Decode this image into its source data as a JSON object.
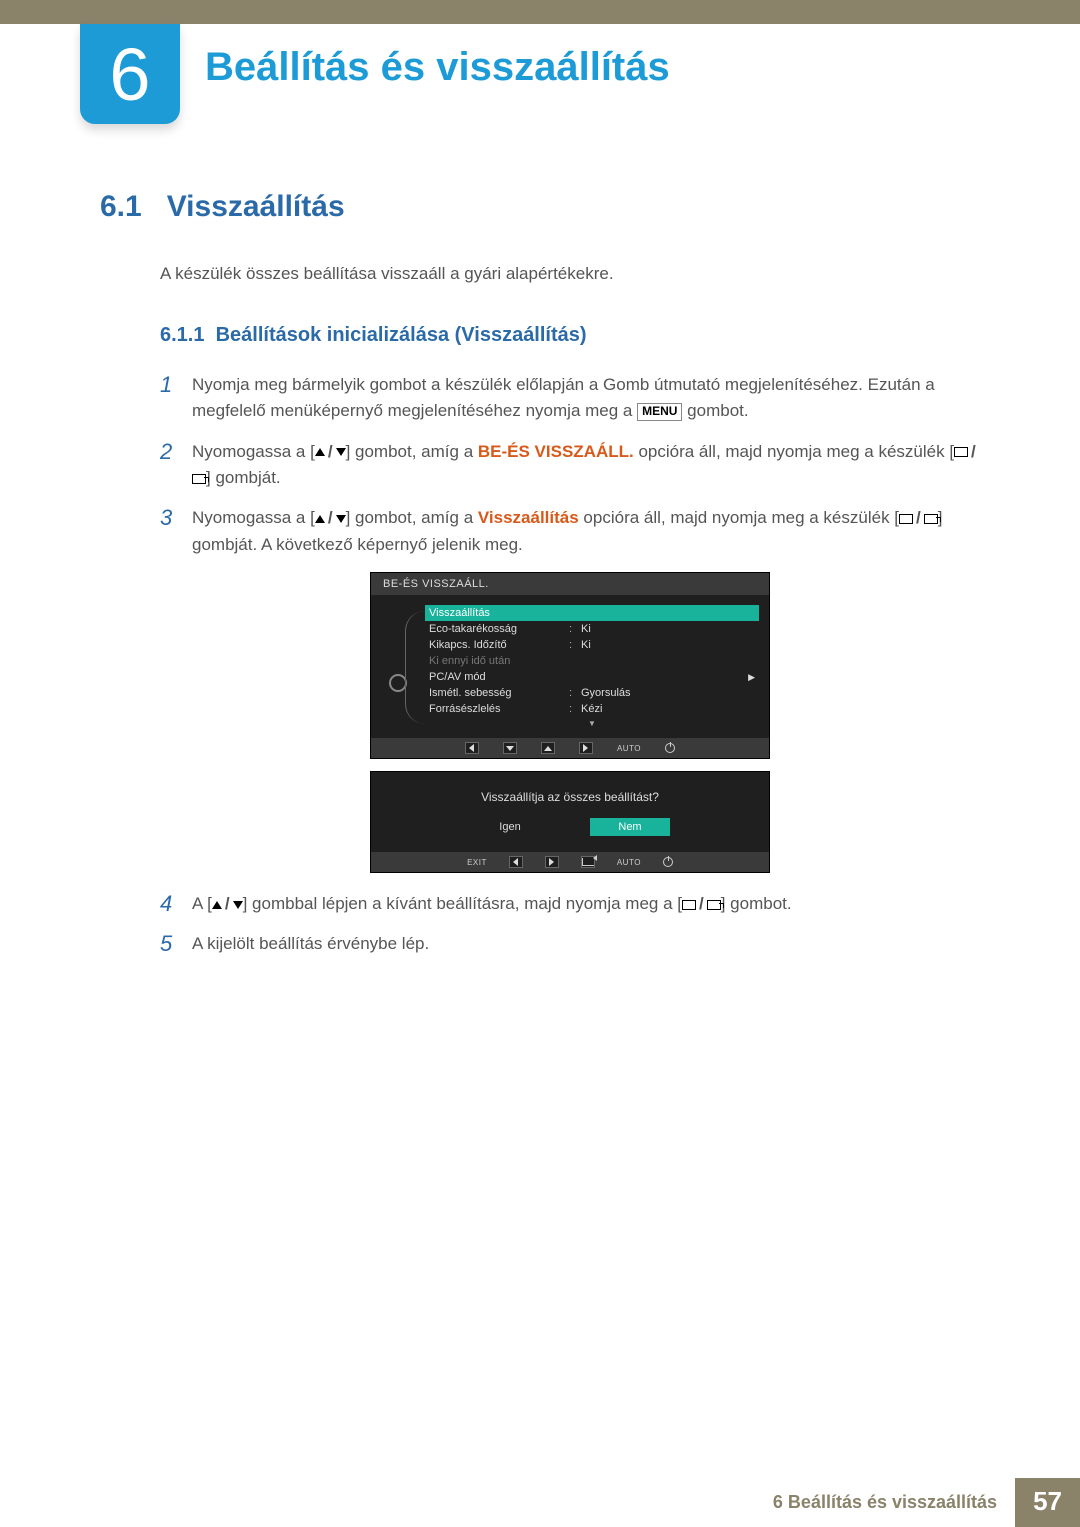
{
  "chapter": {
    "number": "6",
    "title": "Beállítás és visszaállítás"
  },
  "section": {
    "number": "6.1",
    "title": "Visszaállítás"
  },
  "intro": "A készülék összes beállítása visszaáll a gyári alapértékekre.",
  "subsection": {
    "number": "6.1.1",
    "title": "Beállítások inicializálása (Visszaállítás)"
  },
  "steps": {
    "s1": "Nyomja meg bármelyik gombot a készülék előlapján a Gomb útmutató megjelenítéséhez. Ezután a megfelelő menüképernyő megjelenítéséhez nyomja meg a ",
    "s1b": " gombot.",
    "s2a": "Nyomogassa a [",
    "s2b": "] gombot, amíg a ",
    "s2hl": "BE-ÉS VISSZAÁLL.",
    "s2c": " opcióra áll, majd nyomja meg a készülék [",
    "s2d": "] gombját.",
    "s3a": "Nyomogassa a [",
    "s3b": "] gombot, amíg a ",
    "s3hl": "Visszaállítás",
    "s3c": " opcióra áll, majd nyomja meg a készülék [",
    "s3d": "] gombját. A következő képernyő jelenik meg.",
    "s4a": "A [",
    "s4b": "] gombbal lépjen a kívánt beállításra, majd nyomja meg a [",
    "s4c": "] gombot.",
    "s5": "A kijelölt beállítás érvénybe lép."
  },
  "menu_label": "MENU",
  "osd": {
    "title": "BE-ÉS VISSZAÁLL.",
    "items": [
      {
        "label": "Visszaállítás",
        "value": "",
        "selected": true
      },
      {
        "label": "Eco-takarékosság",
        "value": "Ki"
      },
      {
        "label": "Kikapcs. Időzítő",
        "value": "Ki"
      },
      {
        "label": "Ki ennyi idő után",
        "value": "",
        "disabled": true
      },
      {
        "label": "PC/AV mód",
        "value": "",
        "arrow": true
      },
      {
        "label": "Ismétl. sebesség",
        "value": "Gyorsulás"
      },
      {
        "label": "Forrásészlelés",
        "value": "Kézi"
      }
    ],
    "nav_auto": "AUTO"
  },
  "confirm": {
    "question": "Visszaállítja az összes beállítást?",
    "yes": "Igen",
    "no": "Nem",
    "exit": "EXIT",
    "auto": "AUTO"
  },
  "footer": {
    "text": "6 Beállítás és visszaállítás",
    "page": "57"
  }
}
